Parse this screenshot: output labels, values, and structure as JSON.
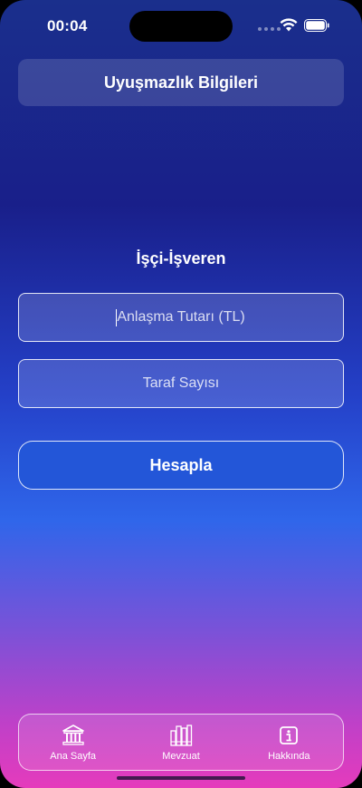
{
  "status_bar": {
    "time": "00:04",
    "icons": [
      "signal-dots-icon",
      "wifi-icon",
      "battery-icon"
    ]
  },
  "header": {
    "title": "Uyuşmazlık Bilgileri"
  },
  "section": {
    "title": "İşçi-İşveren"
  },
  "form": {
    "amount_placeholder": "Anlaşma Tutarı (TL)",
    "amount_value": "",
    "parties_placeholder": "Taraf Sayısı",
    "parties_value": "",
    "submit_label": "Hesapla"
  },
  "tab_bar": {
    "items": [
      {
        "label": "Ana Sayfa",
        "icon": "courthouse-icon"
      },
      {
        "label": "Mevzuat",
        "icon": "books-icon"
      },
      {
        "label": "Hakkında",
        "icon": "info-icon"
      }
    ]
  },
  "colors": {
    "gradient_top": "#1a2f8c",
    "gradient_mid": "#2f66ea",
    "gradient_bottom": "#e53bbc",
    "button": "#2356d8"
  }
}
